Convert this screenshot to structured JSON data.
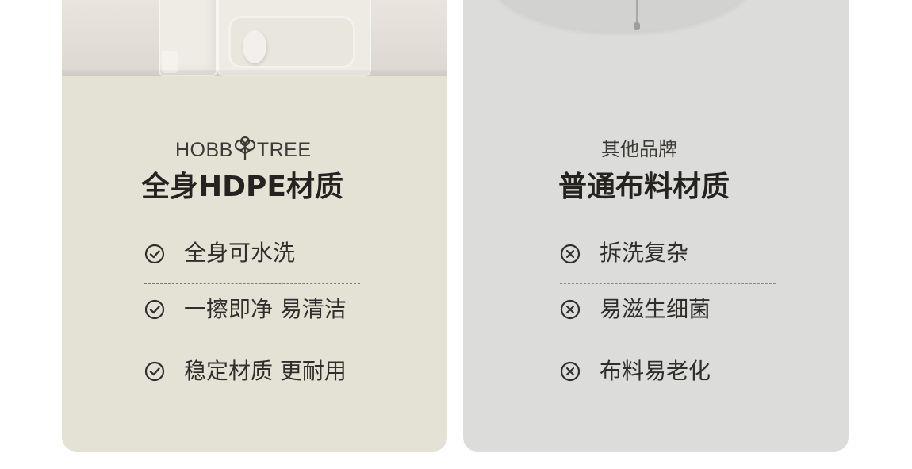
{
  "left_card": {
    "brand_text_a": "HOBB",
    "brand_text_b": "TREE",
    "title": "全身HDPE材质",
    "features": [
      {
        "label": "全身可水洗",
        "icon": "check-circle-icon"
      },
      {
        "label": "一擦即净 易清洁",
        "icon": "check-circle-icon"
      },
      {
        "label": "稳定材质 更耐用",
        "icon": "check-circle-icon"
      }
    ]
  },
  "right_card": {
    "subtitle": "其他品牌",
    "title": "普通布料材质",
    "features": [
      {
        "label": "拆洗复杂",
        "icon": "cross-circle-icon"
      },
      {
        "label": "易滋生细菌",
        "icon": "cross-circle-icon"
      },
      {
        "label": "布料易老化",
        "icon": "cross-circle-icon"
      }
    ]
  },
  "colors": {
    "left_bg": "#e4e1d5",
    "right_bg": "#dcdcdb",
    "text_dark": "#242320"
  }
}
